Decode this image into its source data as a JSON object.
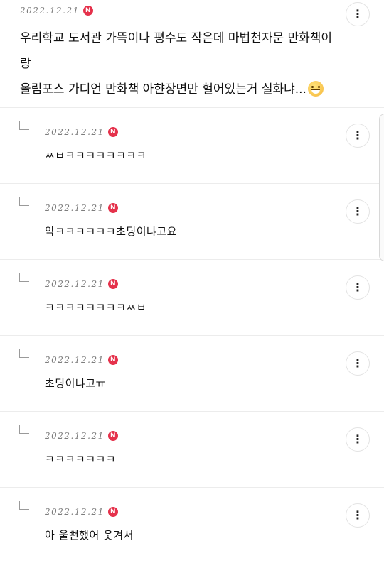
{
  "post": {
    "date": "2022.12.21",
    "badge": "N",
    "text_line1": "우리학교 도서관 가뜩이나 평수도 작은데 마법천자문 만화책이랑",
    "text_line2": "올림포스 가디언 만화책 아햔장면만 헐어있는거 실화냐...",
    "emoji": "grinning-sweat-emoji",
    "menu_icon": "⋮"
  },
  "replies": [
    {
      "date": "2022.12.21",
      "badge": "N",
      "text": "ㅆㅂㅋㅋㅋㅋㅋㅋㅋㅋ",
      "menu_icon": "⋮"
    },
    {
      "date": "2022.12.21",
      "badge": "N",
      "text": "악ㅋㅋㅋㅋㅋㅋ초딩이냐고요",
      "menu_icon": "⋮"
    },
    {
      "date": "2022.12.21",
      "badge": "N",
      "text": "ㅋㅋㅋㅋㅋㅋㅋㅋㅆㅂ",
      "menu_icon": "⋮"
    },
    {
      "date": "2022.12.21",
      "badge": "N",
      "text": "초딩이냐고ㅠ",
      "menu_icon": "⋮"
    },
    {
      "date": "2022.12.21",
      "badge": "N",
      "text": "ㅋㅋㅋㅋㅋㅋㅋ",
      "menu_icon": "⋮"
    },
    {
      "date": "2022.12.21",
      "badge": "N",
      "text": "아 울뻔했어 웃겨서",
      "menu_icon": "⋮"
    }
  ],
  "colors": {
    "badge": "#e5314b",
    "divider": "#ececec",
    "date": "#7d7d7d"
  },
  "icons": {
    "more": "more-vertical-icon",
    "reply": "reply-arrow-icon"
  }
}
